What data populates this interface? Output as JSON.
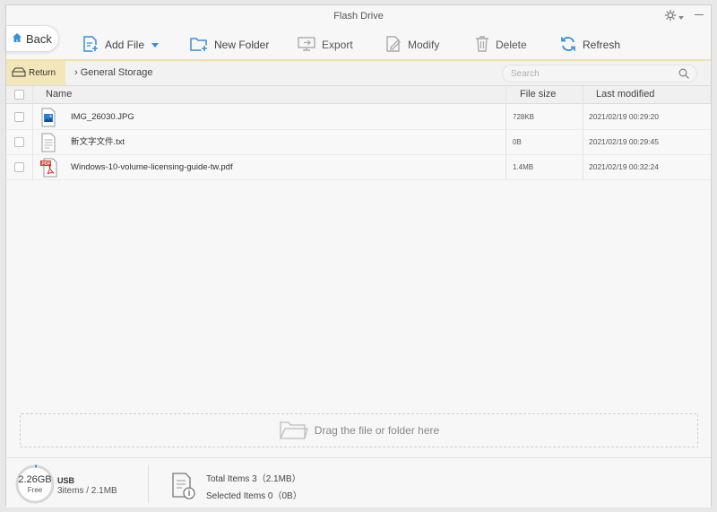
{
  "window": {
    "title": "Flash Drive"
  },
  "nav": {
    "back_label": "Back"
  },
  "toolbar": {
    "add_file": "Add File",
    "new_folder": "New Folder",
    "export": "Export",
    "modify": "Modify",
    "delete": "Delete",
    "refresh": "Refresh"
  },
  "pathbar": {
    "return_label": "Return",
    "breadcrumb": "General Storage",
    "search_placeholder": "Search"
  },
  "table": {
    "headers": {
      "name": "Name",
      "size": "File size",
      "modified": "Last modified"
    },
    "rows": [
      {
        "icon": "image-file-icon",
        "name": "IMG_26030.JPG",
        "size": "728KB",
        "modified": "2021/02/19 00:29:20"
      },
      {
        "icon": "text-file-icon",
        "name": "新文字文件.txt",
        "size": "0B",
        "modified": "2021/02/19 00:29:45"
      },
      {
        "icon": "pdf-file-icon",
        "name": "Windows-10-volume-licensing-guide-tw.pdf",
        "size": "1.4MB",
        "modified": "2021/02/19 00:32:24"
      }
    ]
  },
  "dropzone": {
    "label": "Drag the file or folder here"
  },
  "footer": {
    "free_space": "2.26GB",
    "free_label": "Free",
    "device": "USB",
    "device_summary": "3items / 2.1MB",
    "total_items": "Total Items  3（2.1MB）",
    "selected_items": "Selected Items  0（0B）"
  },
  "colors": {
    "accent": "#3a8fd8",
    "pdf_red": "#d9312a",
    "return_bg": "#f3e6b8"
  }
}
